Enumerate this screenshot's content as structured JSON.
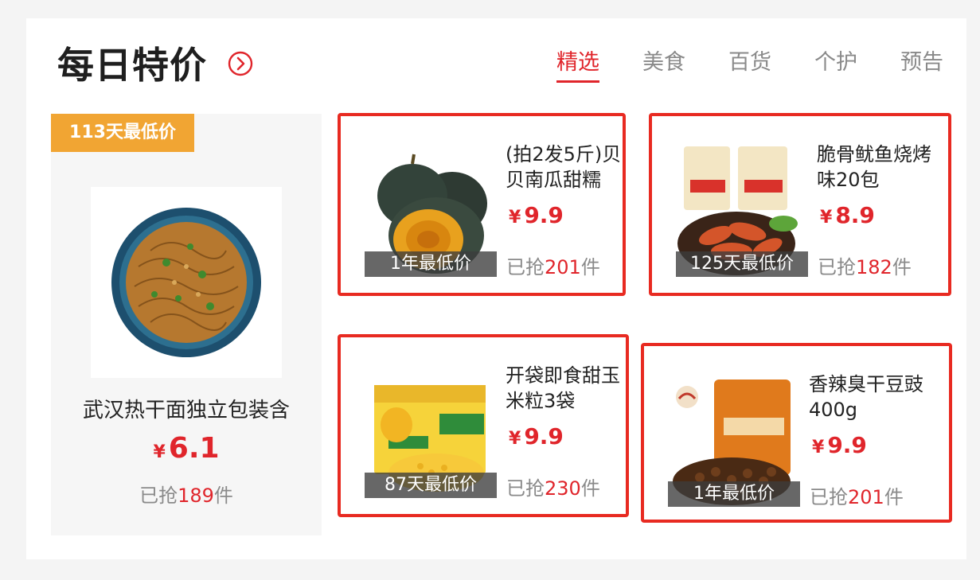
{
  "header": {
    "title": "每日特价",
    "more_icon": "chevron-right-circle-icon",
    "tabs": [
      {
        "label": "精选",
        "active": true
      },
      {
        "label": "美食",
        "active": false
      },
      {
        "label": "百货",
        "active": false
      },
      {
        "label": "个护",
        "active": false
      },
      {
        "label": "预告",
        "active": false
      }
    ]
  },
  "feature": {
    "badge": "113天最低价",
    "image": "hot-dry-noodles-image",
    "name": "武汉热干面独立包装含",
    "currency": "¥",
    "price": "6.1",
    "sold_prefix": "已抢",
    "sold_count": "189",
    "sold_suffix": "件"
  },
  "cards": [
    {
      "name": "(拍2发5斤)贝贝南瓜甜糯",
      "currency": "¥",
      "price": "9.9",
      "tag": "1年最低价",
      "sold_prefix": "已抢",
      "sold_count": "201",
      "sold_suffix": "件",
      "image": "pumpkin-image"
    },
    {
      "name": "脆骨鱿鱼烧烤味20包",
      "currency": "¥",
      "price": "8.9",
      "tag": "125天最低价",
      "sold_prefix": "已抢",
      "sold_count": "182",
      "sold_suffix": "件",
      "image": "squid-snack-image"
    },
    {
      "name": "开袋即食甜玉米粒3袋",
      "currency": "¥",
      "price": "9.9",
      "tag": "87天最低价",
      "sold_prefix": "已抢",
      "sold_count": "230",
      "sold_suffix": "件",
      "image": "sweet-corn-image"
    },
    {
      "name": "香辣臭干豆豉400g",
      "currency": "¥",
      "price": "9.9",
      "tag": "1年最低价",
      "sold_prefix": "已抢",
      "sold_count": "201",
      "sold_suffix": "件",
      "image": "fermented-beans-image"
    }
  ],
  "colors": {
    "accent": "#e0252b",
    "card_border": "#e82a21",
    "badge": "#f1a533",
    "muted": "#8a8a8a"
  }
}
